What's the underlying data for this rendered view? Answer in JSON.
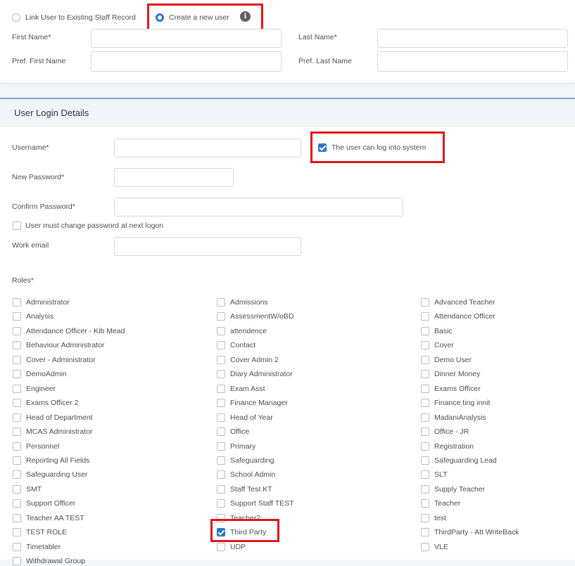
{
  "user_link": {
    "link_existing_label": "Link User to Existing Staff Record",
    "create_new_label": "Create a new user",
    "info_icon": "info-icon"
  },
  "names": {
    "first_name_label": "First Name*",
    "last_name_label": "Last Name*",
    "pref_first_label": "Pref. First Name",
    "pref_last_label": "Pref. Last Name",
    "first_name_value": "",
    "last_name_value": "",
    "pref_first_value": "",
    "pref_last_value": ""
  },
  "login": {
    "title": "User Login Details",
    "username_label": "Username*",
    "can_login_label": "The user can log into system",
    "can_login_checked": true,
    "new_password_label": "New Password*",
    "confirm_password_label": "Confirm Password*",
    "must_change_label": "User must change password at next logon",
    "must_change_checked": false,
    "work_email_label": "Work email",
    "username_value": "",
    "new_password_value": "",
    "confirm_password_value": "",
    "work_email_value": ""
  },
  "roles": {
    "label": "Roles*",
    "items": [
      {
        "label": "Administrator",
        "checked": false
      },
      {
        "label": "Admissions",
        "checked": false
      },
      {
        "label": "Advanced Teacher",
        "checked": false
      },
      {
        "label": "Analysis",
        "checked": false
      },
      {
        "label": "AssessmentW/oBD",
        "checked": false
      },
      {
        "label": "Attendance Officer",
        "checked": false
      },
      {
        "label": "Attendance Officer - Kib Mead",
        "checked": false
      },
      {
        "label": "attendence",
        "checked": false
      },
      {
        "label": "Basic",
        "checked": false
      },
      {
        "label": "Behaviour Administrator",
        "checked": false
      },
      {
        "label": "Contact",
        "checked": false
      },
      {
        "label": "Cover",
        "checked": false
      },
      {
        "label": "Cover - Administrator",
        "checked": false
      },
      {
        "label": "Cover Admin 2",
        "checked": false
      },
      {
        "label": "Demo User",
        "checked": false
      },
      {
        "label": "DemoAdmin",
        "checked": false
      },
      {
        "label": "Diary Administrator",
        "checked": false
      },
      {
        "label": "Dinner Money",
        "checked": false
      },
      {
        "label": "Engineer",
        "checked": false
      },
      {
        "label": "Exam Asst",
        "checked": false
      },
      {
        "label": "Exams Officer",
        "checked": false
      },
      {
        "label": "Exams Officer 2",
        "checked": false
      },
      {
        "label": "Finance Manager",
        "checked": false
      },
      {
        "label": "Finance ting innit",
        "checked": false
      },
      {
        "label": "Head of Department",
        "checked": false
      },
      {
        "label": "Head of Year",
        "checked": false
      },
      {
        "label": "MadaniAnalysis",
        "checked": false
      },
      {
        "label": "MCAS Administrator",
        "checked": false
      },
      {
        "label": "Office",
        "checked": false
      },
      {
        "label": "Office - JR",
        "checked": false
      },
      {
        "label": "Personnel",
        "checked": false
      },
      {
        "label": "Primary",
        "checked": false
      },
      {
        "label": "Registration",
        "checked": false
      },
      {
        "label": "Reporting All Fields",
        "checked": false
      },
      {
        "label": "Safeguarding",
        "checked": false
      },
      {
        "label": "Safeguarding Lead",
        "checked": false
      },
      {
        "label": "Safeguarding User",
        "checked": false
      },
      {
        "label": "School Admin",
        "checked": false
      },
      {
        "label": "SLT",
        "checked": false
      },
      {
        "label": "SMT",
        "checked": false
      },
      {
        "label": "Staff Test KT",
        "checked": false
      },
      {
        "label": "Supply Teacher",
        "checked": false
      },
      {
        "label": "Support Officer",
        "checked": false
      },
      {
        "label": "Support Staff TEST",
        "checked": false
      },
      {
        "label": "Teacher",
        "checked": false
      },
      {
        "label": "Teacher AA TEST",
        "checked": false
      },
      {
        "label": "Teacher2",
        "checked": false
      },
      {
        "label": "test",
        "checked": false
      },
      {
        "label": "TEST ROLE",
        "checked": false
      },
      {
        "label": "Third Party",
        "checked": true
      },
      {
        "label": "ThirdParty - Att WriteBack",
        "checked": false
      },
      {
        "label": "Timetabler",
        "checked": false
      },
      {
        "label": "UDP",
        "checked": false
      },
      {
        "label": "VLE",
        "checked": false
      },
      {
        "label": "Withdrawal Group",
        "checked": false
      }
    ]
  },
  "colors": {
    "accent": "#2f77c8",
    "highlight": "#e0161c",
    "header_bg": "#f1f4f8"
  }
}
